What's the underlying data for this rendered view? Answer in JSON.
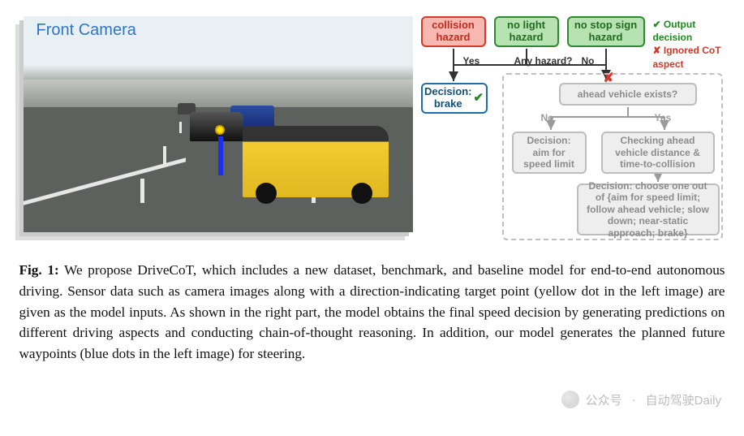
{
  "figure": {
    "camera_label": "Front Camera",
    "flow": {
      "hazard_red": "collision hazard",
      "hazard_green1": "no light hazard",
      "hazard_green2": "no stop sign hazard",
      "legend_ok": "✔ Output decision",
      "legend_no": "✘ Ignored CoT aspect",
      "yes": "Yes",
      "any_hazard": "Any hazard?",
      "no": "No",
      "decision_brake": "Decision: brake",
      "ahead_exists": "ahead vehicle exists?",
      "g_no": "No",
      "g_yes": "Yes",
      "aim": "Decision: aim for speed limit",
      "check": "Checking ahead vehicle distance & time-to-collision",
      "choose": "Decision: choose one out of {aim for speed limit; follow ahead vehicle; slow down; near-static approach; brake}"
    }
  },
  "caption": {
    "label": "Fig. 1:",
    "text": "We propose DriveCoT, which includes a new dataset, benchmark, and baseline model for end-to-end autonomous driving. Sensor data such as camera images along with a direction-indicating target point (yellow dot in the left image) are given as the model inputs. As shown in the right part, the model obtains the final speed decision by generating predictions on different driving aspects and conducting chain-of-thought reasoning. In addition, our model generates the planned future waypoints (blue dots in the left image) for steering."
  },
  "watermark": {
    "prefix": "公众号",
    "sep": "·",
    "name": "自动驾驶Daily"
  }
}
